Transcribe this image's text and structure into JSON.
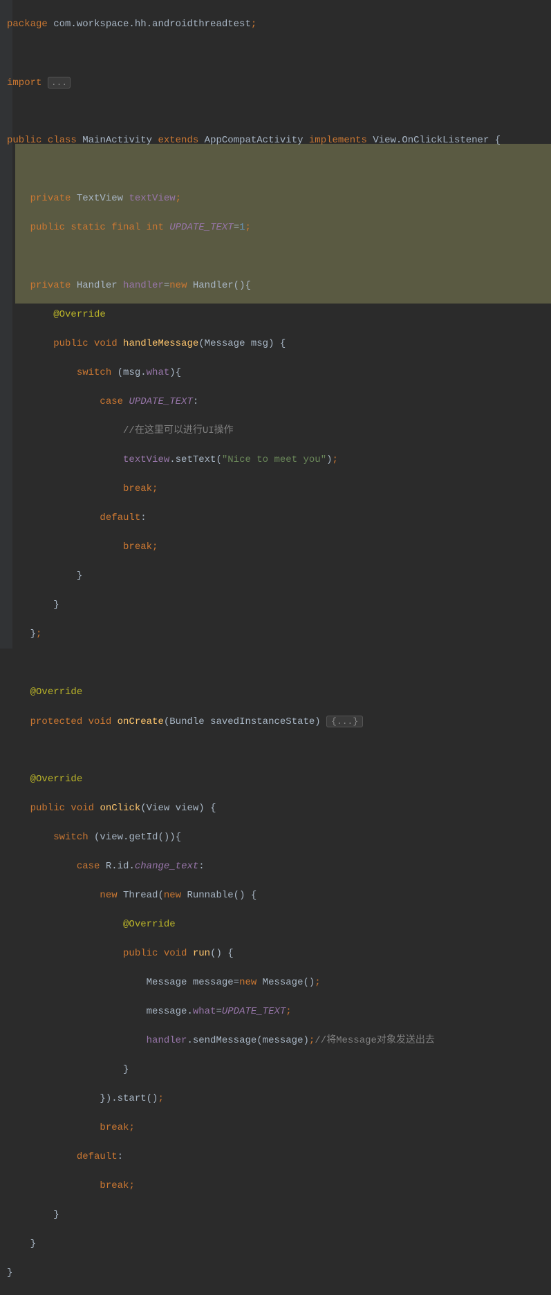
{
  "code": {
    "l1_package": "package",
    "l1_pkg": " com.workspace.hh.androidthreadtest",
    "l3_import": "import ",
    "l3_folded": "...",
    "l5_public": "public ",
    "l5_class": "class ",
    "l5_name": "MainActivity ",
    "l5_extends": "extends ",
    "l5_super": "AppCompatActivity ",
    "l5_implements": "implements ",
    "l5_iface": "View.OnClickListener ",
    "l5_brace": "{",
    "l7_private": "private ",
    "l7_type": "TextView ",
    "l7_field": "textView",
    "l8_public": "public ",
    "l8_static": "static ",
    "l8_final": "final ",
    "l8_int": "int ",
    "l8_name": "UPDATE_TEXT",
    "l8_eq": "=",
    "l8_val": "1",
    "l10_private": "private ",
    "l10_type": "Handler ",
    "l10_field": "handler",
    "l10_eq": "=",
    "l10_new": "new ",
    "l10_ctor": "Handler(){",
    "l11_anno": "@Override",
    "l12_public": "public ",
    "l12_void": "void ",
    "l12_method": "handleMessage",
    "l12_sig": "(Message msg) {",
    "l13_switch": "switch ",
    "l13_open": "(msg.",
    "l13_what": "what",
    "l13_close": "){",
    "l14_case": "case ",
    "l14_const": "UPDATE_TEXT",
    "l14_colon": ":",
    "l15_comment": "//在这里可以进行UI操作",
    "l16_field": "textView",
    "l16_dot": ".setText(",
    "l16_str": "\"Nice to meet you\"",
    "l16_close": ")",
    "l17_break": "break",
    "l18_default": "default",
    "l18_colon": ":",
    "l19_break": "break",
    "l20_brace": "}",
    "l21_brace": "}",
    "l22_brace": "}",
    "l24_anno": "@Override",
    "l25_protected": "protected ",
    "l25_void": "void ",
    "l25_method": "onCreate",
    "l25_sig": "(Bundle savedInstanceState) ",
    "l25_folded": "{...}",
    "l27_anno": "@Override",
    "l28_public": "public ",
    "l28_void": "void ",
    "l28_method": "onClick",
    "l28_sig": "(View view) {",
    "l29_switch": "switch ",
    "l29_expr": "(view.getId()){",
    "l30_case": "case ",
    "l30_r": "R.id.",
    "l30_id": "change_text",
    "l30_colon": ":",
    "l31_new": "new ",
    "l31_thread": "Thread(",
    "l31_new2": "new ",
    "l31_run": "Runnable() {",
    "l32_anno": "@Override",
    "l33_public": "public ",
    "l33_void": "void ",
    "l33_method": "run",
    "l33_sig": "() {",
    "l34_type": "Message message=",
    "l34_new": "new ",
    "l34_ctor": "Message()",
    "l35_msg": "message.",
    "l35_what": "what",
    "l35_eq": "=",
    "l35_const": "UPDATE_TEXT",
    "l36_handler": "handler",
    "l36_call": ".sendMessage(message)",
    "l36_comment": "//将Message对象发送出去",
    "l37_brace": "}",
    "l38_close": "}).start()",
    "l39_break": "break",
    "l40_default": "default",
    "l40_colon": ":",
    "l41_break": "break",
    "l42_brace": "}",
    "l43_brace": "}",
    "l44_brace": "}"
  }
}
